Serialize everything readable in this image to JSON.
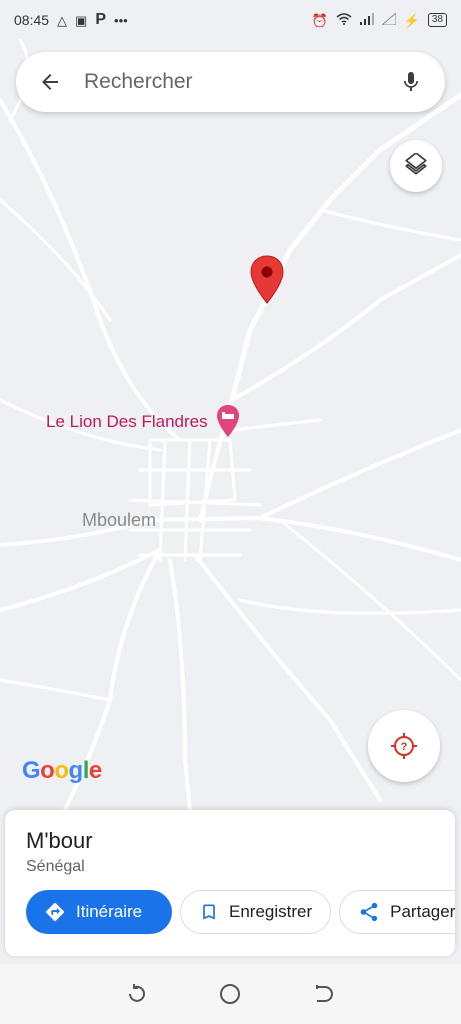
{
  "status_bar": {
    "time": "08:45",
    "parking_label": "P",
    "more_dots": "•••",
    "battery": "38"
  },
  "search": {
    "placeholder": "Rechercher"
  },
  "map": {
    "poi_name": "Le Lion Des Flandres",
    "place_label": "Mboulem",
    "google_logo": [
      "G",
      "o",
      "o",
      "g",
      "l",
      "e"
    ],
    "google_colors": [
      "#4285F4",
      "#EA4335",
      "#FBBC05",
      "#4285F4",
      "#34A853",
      "#EA4335"
    ],
    "pin_color": "#e53935",
    "poi_color": "#c2185b"
  },
  "place_card": {
    "name": "M'bour",
    "subtitle": "Sénégal",
    "actions": {
      "directions": "Itinéraire",
      "save": "Enregistrer",
      "share": "Partager"
    }
  },
  "icons": {
    "back": "arrow-left-icon",
    "mic": "microphone-icon",
    "layers": "layers-icon",
    "location": "my-location-icon",
    "directions": "directions-icon",
    "save": "bookmark-icon",
    "share": "share-icon"
  }
}
